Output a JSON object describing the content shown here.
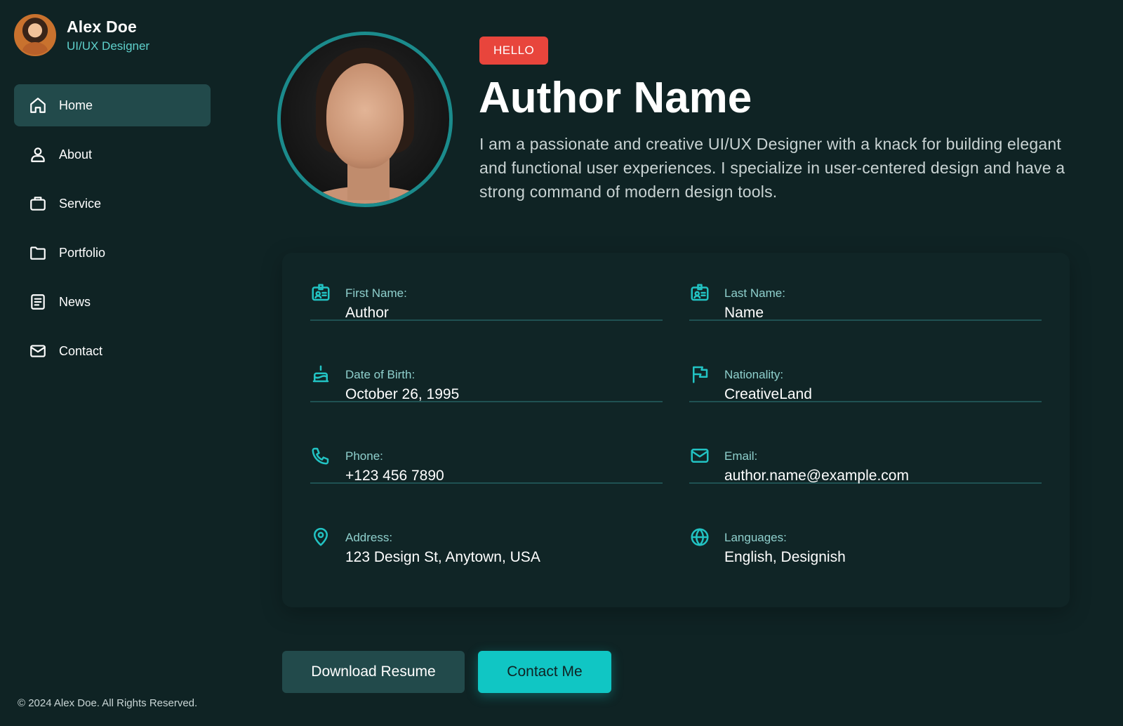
{
  "profile": {
    "name": "Alex Doe",
    "role": "UI/UX Designer",
    "avatar_icon": "person-avatar"
  },
  "nav": {
    "items": [
      {
        "label": "Home",
        "icon": "home-icon",
        "active": true
      },
      {
        "label": "About",
        "icon": "user-icon",
        "active": false
      },
      {
        "label": "Service",
        "icon": "briefcase-icon",
        "active": false
      },
      {
        "label": "Portfolio",
        "icon": "folder-icon",
        "active": false
      },
      {
        "label": "News",
        "icon": "news-icon",
        "active": false
      },
      {
        "label": "Contact",
        "icon": "mail-icon",
        "active": false
      }
    ]
  },
  "footer": {
    "copyright": "© 2024 Alex Doe. All Rights Reserved."
  },
  "hero": {
    "badge": "HELLO",
    "title": "Author Name",
    "description": "I am a passionate and creative UI/UX Designer with a knack for building elegant and functional user experiences. I specialize in user-centered design and have a strong command of modern design tools."
  },
  "info": {
    "first_name": {
      "label": "First Name:",
      "value": "Author",
      "icon": "id-card-icon"
    },
    "last_name": {
      "label": "Last Name:",
      "value": "Name",
      "icon": "id-card-icon"
    },
    "dob": {
      "label": "Date of Birth:",
      "value": "October 26, 1995",
      "icon": "cake-icon"
    },
    "nationality": {
      "label": "Nationality:",
      "value": "CreativeLand",
      "icon": "flag-icon"
    },
    "phone": {
      "label": "Phone:",
      "value": "+123 456 7890",
      "icon": "phone-icon"
    },
    "email": {
      "label": "Email:",
      "value": "author.name@example.com",
      "icon": "mail-icon"
    },
    "address": {
      "label": "Address:",
      "value": "123 Design St, Anytown, USA",
      "icon": "map-pin-icon"
    },
    "languages": {
      "label": "Languages:",
      "value": "English, Designish",
      "icon": "globe-icon"
    }
  },
  "buttons": {
    "download": "Download Resume",
    "contact": "Contact Me"
  },
  "colors": {
    "background": "#0f2324",
    "accent": "#10c6c4",
    "badge": "#e8453c",
    "nav_active": "#224a4b"
  }
}
